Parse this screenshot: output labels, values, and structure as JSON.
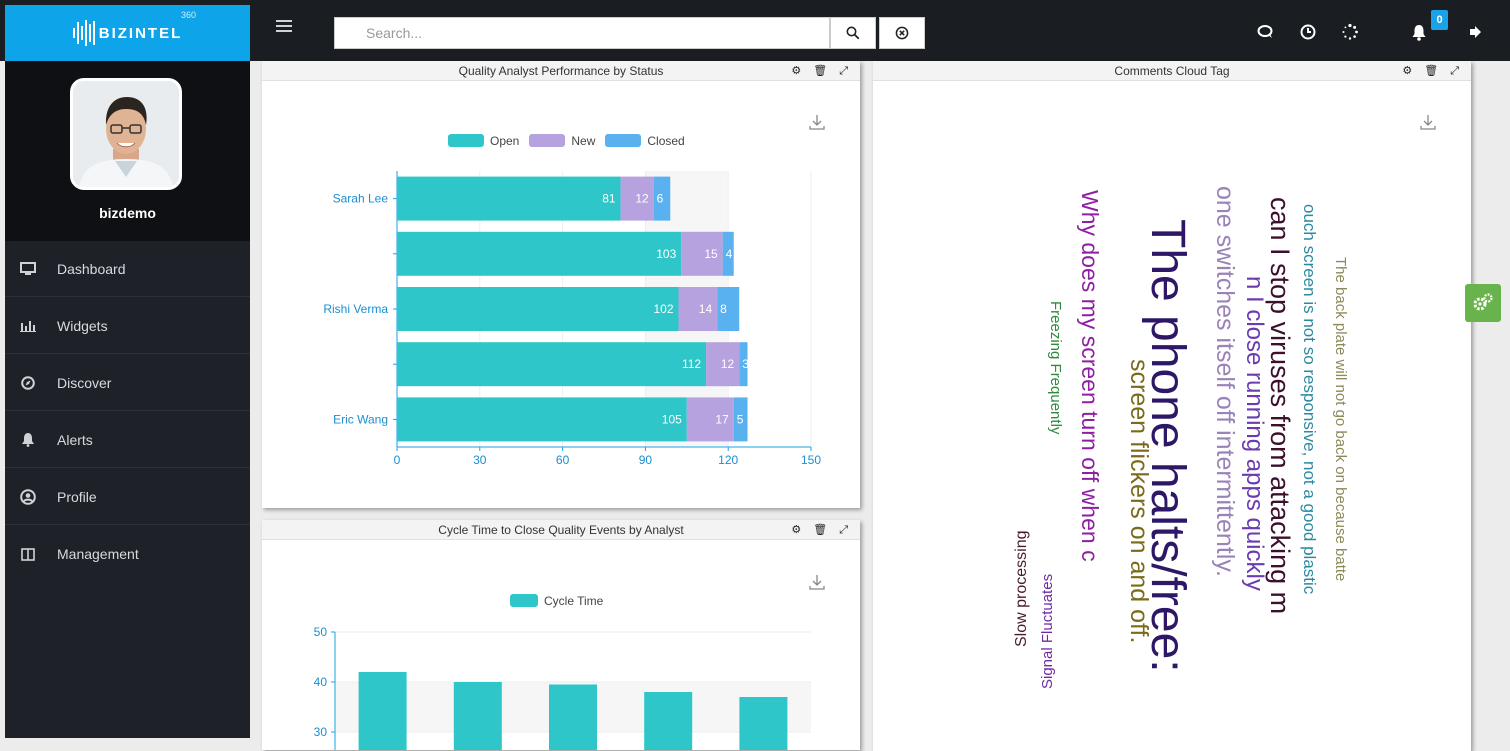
{
  "brand": {
    "name": "BIZINTEL",
    "superscript": "360"
  },
  "search": {
    "placeholder": "Search..."
  },
  "notifications": {
    "count": "0"
  },
  "user": {
    "name": "bizdemo"
  },
  "sidebar": {
    "items": [
      {
        "label": "Dashboard",
        "icon": "monitor-icon"
      },
      {
        "label": "Widgets",
        "icon": "bar-chart-icon"
      },
      {
        "label": "Discover",
        "icon": "compass-icon"
      },
      {
        "label": "Alerts",
        "icon": "bell-icon"
      },
      {
        "label": "Profile",
        "icon": "user-circle-icon"
      },
      {
        "label": "Management",
        "icon": "columns-icon"
      }
    ]
  },
  "panels": {
    "quality": {
      "title": "Quality Analyst Performance by Status"
    },
    "cycle": {
      "title": "Cycle Time to Close Quality Events by Analyst"
    },
    "cloud": {
      "title": "Comments Cloud Tag"
    }
  },
  "colors": {
    "open": "#2ec6c8",
    "new": "#b6a2de",
    "closed": "#5ab1ef",
    "accent": "#0ea4e9"
  },
  "chart_data": [
    {
      "type": "bar",
      "orientation": "horizontal",
      "stacked": true,
      "categories": [
        "Sarah Lee",
        "",
        "Rishi Verma",
        "",
        "Eric Wang"
      ],
      "series": [
        {
          "name": "Open",
          "values": [
            81,
            103,
            102,
            112,
            105
          ]
        },
        {
          "name": "New",
          "values": [
            12,
            15,
            14,
            12,
            17
          ]
        },
        {
          "name": "Closed",
          "values": [
            6,
            4,
            8,
            3,
            5
          ]
        }
      ],
      "xticks": [
        "0",
        "30",
        "60",
        "90",
        "120",
        "150"
      ],
      "xlim": [
        0,
        150
      ],
      "legend": "top-center"
    },
    {
      "type": "bar",
      "categories": [
        "",
        "",
        "",
        "",
        ""
      ],
      "series": [
        {
          "name": "Cycle Time",
          "values": [
            42,
            40,
            39.5,
            38,
            37
          ]
        }
      ],
      "yticks": [
        "50",
        "40",
        "30"
      ],
      "ylim": [
        30,
        50
      ],
      "legend": "top-center"
    }
  ],
  "cloud_words": [
    {
      "text": "Why does my screen turn off when c",
      "color": "#8e1fa3"
    },
    {
      "text": "The phone halts/free:",
      "color": "#2d1766"
    },
    {
      "text": "can I stop viruses from attacking m",
      "color": "#3d0f2d"
    },
    {
      "text": "one switches itself off intermittently.",
      "color": "#9b82b8"
    },
    {
      "text": "screen flickers on and off.",
      "color": "#7a6a1a"
    },
    {
      "text": "n I close running apps quickly",
      "color": "#6b3bb0"
    },
    {
      "text": "ouch screen is not so responsive, not a good plastic",
      "color": "#2b8aa0"
    },
    {
      "text": "The back plate will not go back on because batte",
      "color": "#8b8a5a"
    },
    {
      "text": "Freezing Frequently",
      "color": "#2e8b3e"
    },
    {
      "text": "Signal Fluctuates",
      "color": "#6f2aa3"
    },
    {
      "text": "Slow processing",
      "color": "#4a1a2a"
    }
  ]
}
